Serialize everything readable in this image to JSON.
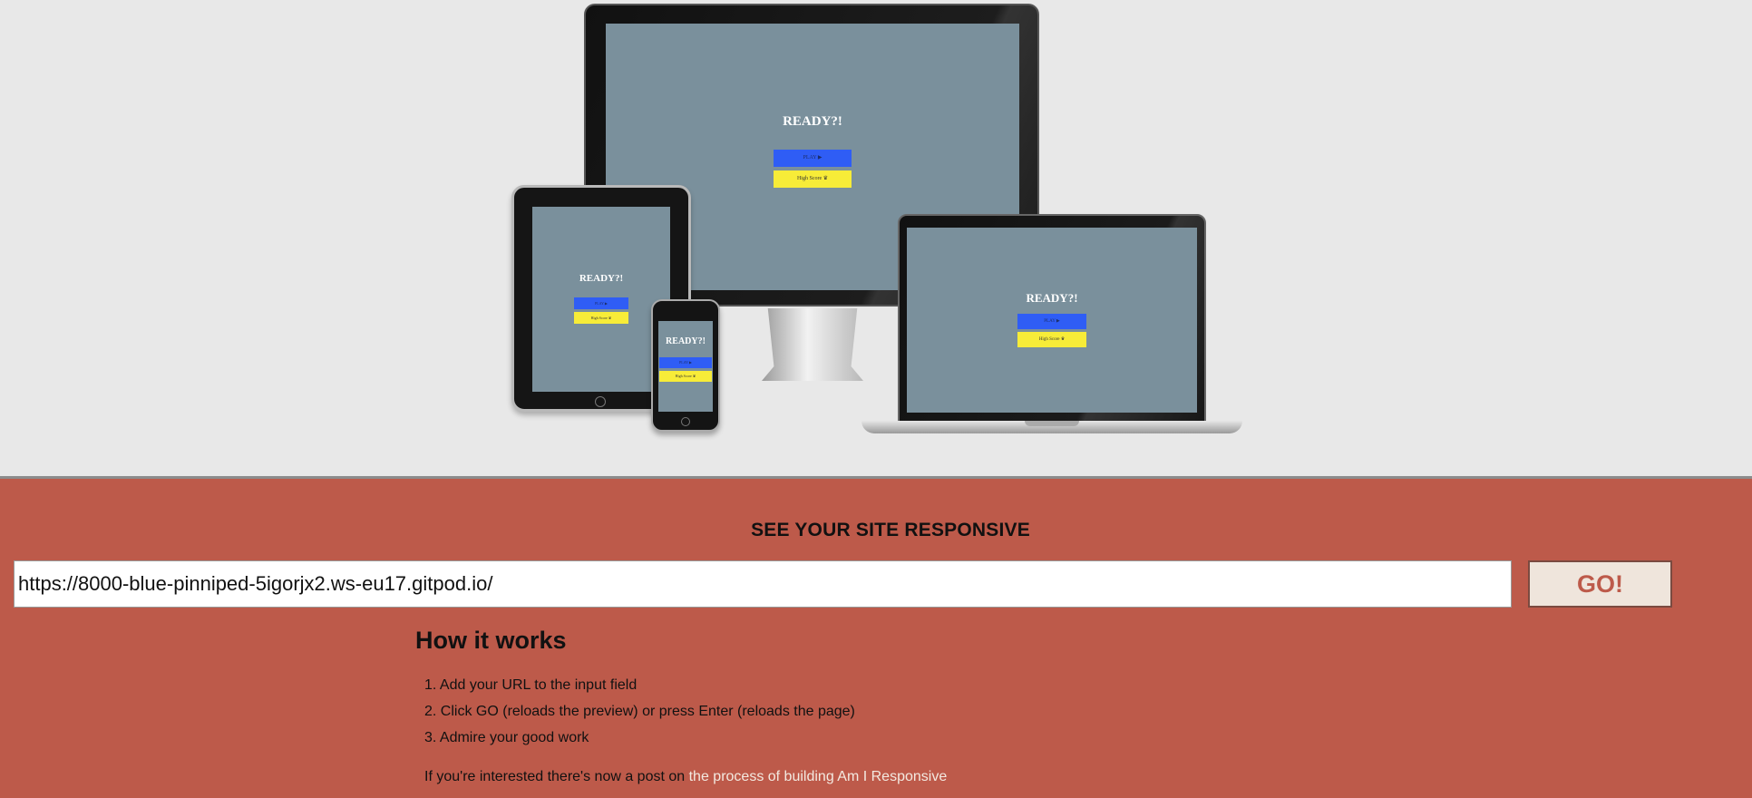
{
  "preview": {
    "title": "READY?!",
    "play_label": "PLAY ▶",
    "high_label": "High Score ♛"
  },
  "main": {
    "heading": "SEE YOUR SITE RESPONSIVE",
    "url_value": "https://8000-blue-pinniped-5igorjx2.ws-eu17.gitpod.io/",
    "go_label": "GO!",
    "how_title": "How it works",
    "steps": [
      "1. Add your URL to the input field",
      "2. Click GO (reloads the preview) or press Enter (reloads the page)",
      "3. Admire your good work"
    ],
    "note_text": "If you're interested there's now a post on ",
    "note_link": "the process of building Am I Responsive"
  },
  "colors": {
    "accent": "#bd5a4a",
    "screen": "#7a909c",
    "play": "#2f5df5",
    "high": "#f7ec38"
  }
}
